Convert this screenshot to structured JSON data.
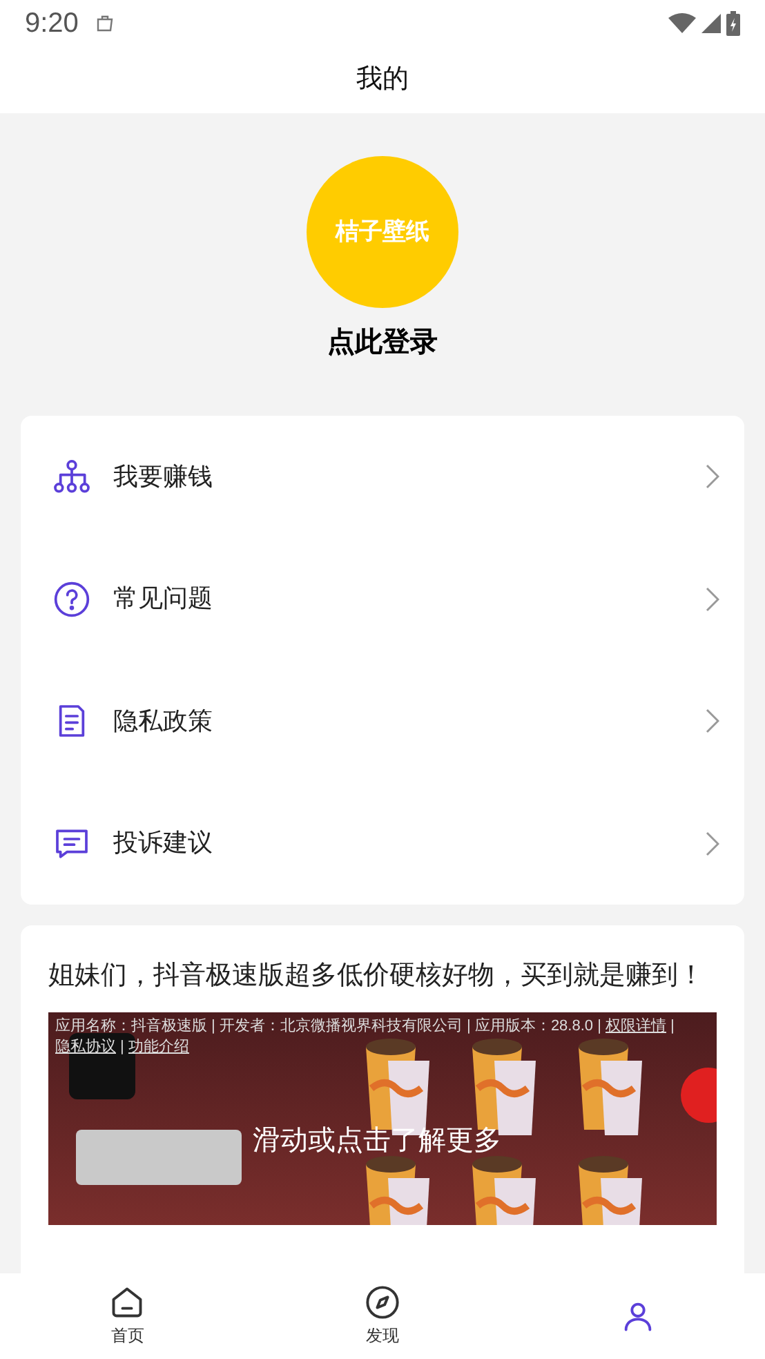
{
  "status_bar": {
    "time": "9:20"
  },
  "header": {
    "title": "我的"
  },
  "profile": {
    "avatar_text": "桔子壁纸",
    "login": "点此登录"
  },
  "menu": [
    {
      "kind": "network",
      "label": "我要赚钱"
    },
    {
      "kind": "question",
      "label": "常见问题"
    },
    {
      "kind": "document",
      "label": "隐私政策"
    },
    {
      "kind": "message",
      "label": "投诉建议"
    }
  ],
  "ad": {
    "title": "姐妹们，抖音极速版超多低价硬核好物，买到就是赚到！",
    "info": "应用名称：抖音极速版 | 开发者：北京微播视界科技有限公司 | 应用版本：28.8.0 | ",
    "links": [
      "权限详情",
      "隐私协议",
      "功能介绍"
    ],
    "separator": " | ",
    "overlay": "滑动或点击了解更多"
  },
  "bottom_nav": [
    {
      "kind": "home",
      "label": "首页",
      "selected": false
    },
    {
      "kind": "compass",
      "label": "发现",
      "selected": false
    },
    {
      "kind": "user",
      "selected": true
    }
  ]
}
